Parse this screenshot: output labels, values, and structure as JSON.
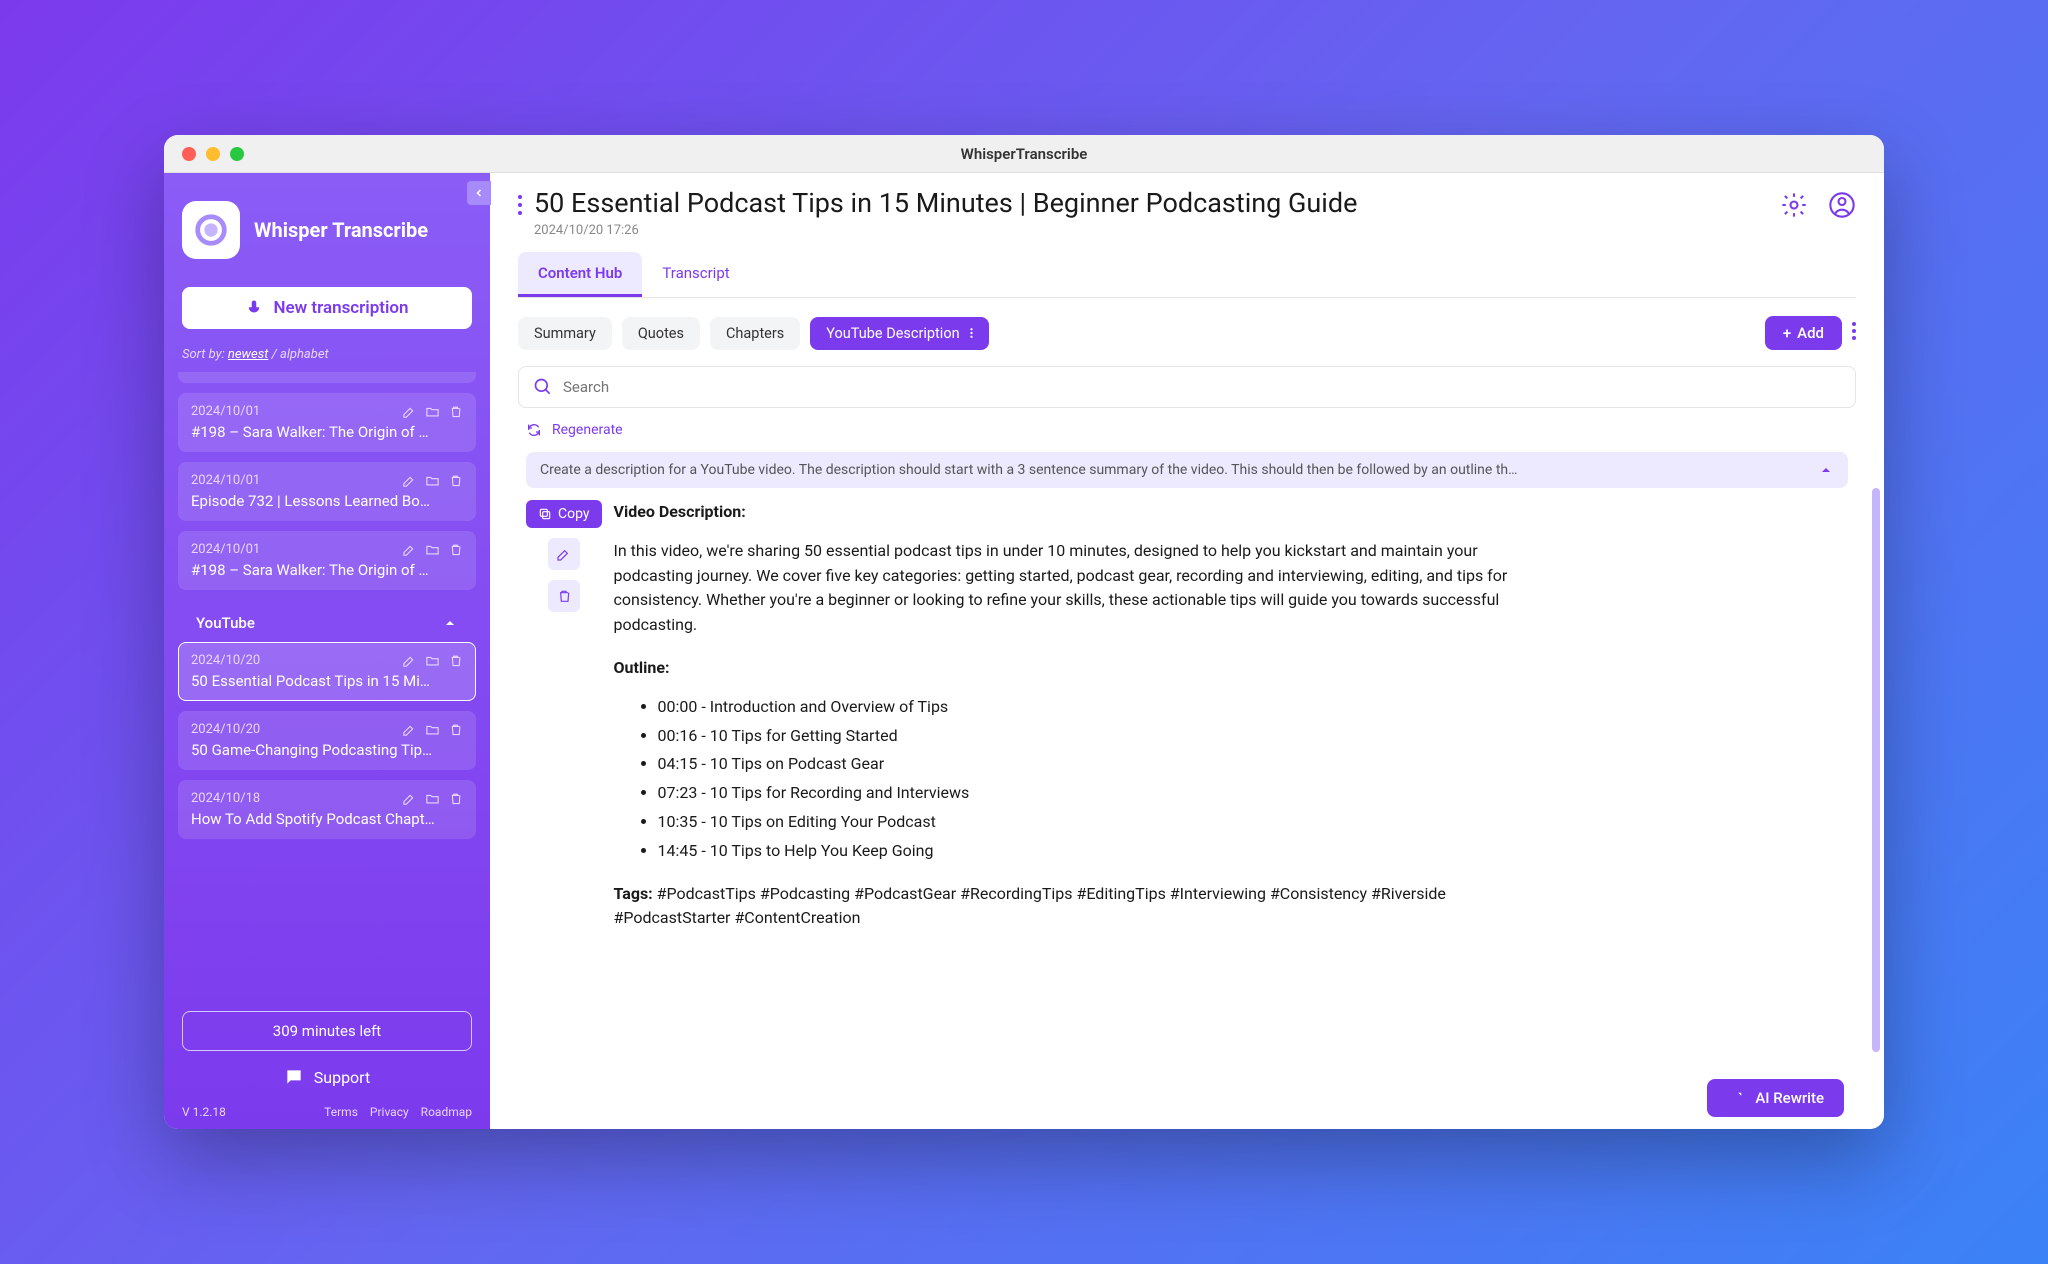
{
  "window": {
    "title": "WhisperTranscribe"
  },
  "brand": {
    "name": "Whisper Transcribe"
  },
  "sidebar": {
    "new_transcription": "New transcription",
    "sort_label": "Sort by:",
    "sort_active": "newest",
    "sort_alt": "alphabet",
    "section_youtube": "YouTube",
    "minutes_left": "309 minutes left",
    "support": "Support",
    "version": "V 1.2.18",
    "links": {
      "terms": "Terms",
      "privacy": "Privacy",
      "roadmap": "Roadmap"
    },
    "items_top": [
      {
        "date": "",
        "title": ""
      },
      {
        "date": "2024/10/01",
        "title": "#198 – Sara Walker: The Origin of …"
      },
      {
        "date": "2024/10/01",
        "title": "Episode 732 | Lessons Learned Bo…"
      },
      {
        "date": "2024/10/01",
        "title": "#198 – Sara Walker: The Origin of …"
      }
    ],
    "items_youtube": [
      {
        "date": "2024/10/20",
        "title": "50 Essential Podcast Tips in 15 Mi…",
        "selected": true
      },
      {
        "date": "2024/10/20",
        "title": "50 Game-Changing Podcasting Tip…"
      },
      {
        "date": "2024/10/18",
        "title": "How To Add Spotify Podcast Chapt…"
      }
    ]
  },
  "doc": {
    "title": "50 Essential Podcast Tips in 15 Minutes | Beginner Podcasting Guide",
    "date": "2024/10/20 17:26"
  },
  "tabs": {
    "content_hub": "Content Hub",
    "transcript": "Transcript"
  },
  "chips": {
    "summary": "Summary",
    "quotes": "Quotes",
    "chapters": "Chapters",
    "yt_desc": "YouTube Description",
    "add": "Add"
  },
  "search": {
    "placeholder": "Search"
  },
  "regenerate": "Regenerate",
  "prompt": "Create a description for a YouTube video. The description should start with a 3 sentence summary of the video. This should then be followed by an outline th…",
  "actions": {
    "copy": "Copy",
    "ai_rewrite": "AI Rewrite"
  },
  "content": {
    "heading": "Video Description:",
    "para": "In this video, we're sharing 50 essential podcast tips in under 10 minutes, designed to help you kickstart and maintain your podcasting journey. We cover five key categories: getting started, podcast gear, recording and interviewing, editing, and tips for consistency. Whether you're a beginner or looking to refine your skills, these actionable tips will guide you towards successful podcasting.",
    "outline_heading": "Outline:",
    "outline": [
      "00:00 - Introduction and Overview of Tips",
      "00:16 - 10 Tips for Getting Started",
      "04:15 - 10 Tips on Podcast Gear",
      "07:23 - 10 Tips for Recording and Interviews",
      "10:35 - 10 Tips on Editing Your Podcast",
      "14:45 - 10 Tips to Help You Keep Going"
    ],
    "tags_label": "Tags:",
    "tags": "#PodcastTips #Podcasting #PodcastGear #RecordingTips #EditingTips #Interviewing #Consistency #Riverside #PodcastStarter #ContentCreation"
  }
}
